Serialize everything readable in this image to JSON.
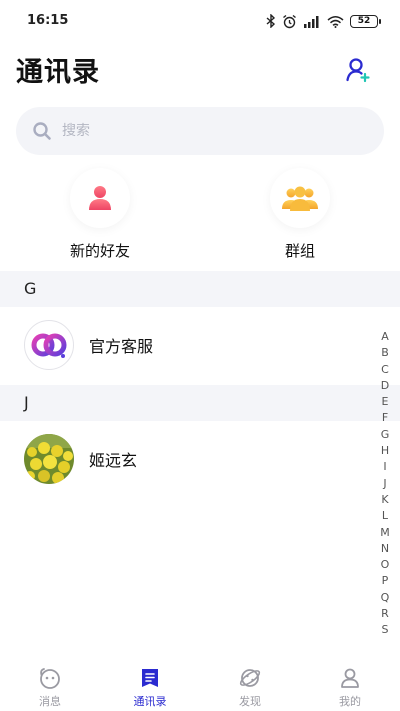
{
  "status_bar": {
    "time": "16:15",
    "battery": "52",
    "icons": [
      "bluetooth-icon",
      "alarm-icon",
      "signal-icon",
      "wifi-icon",
      "battery-icon"
    ]
  },
  "header": {
    "title": "通讯录",
    "add_contact_icon": "add-person-icon"
  },
  "search": {
    "placeholder": "搜索"
  },
  "quick_actions": [
    {
      "label": "新的好友",
      "icon": "person-icon",
      "color": "#f0566a"
    },
    {
      "label": "群组",
      "icon": "group-icon",
      "color": "#f7b23b"
    }
  ],
  "sections": [
    {
      "letter": "G",
      "contacts": [
        {
          "name": "官方客服",
          "avatar": "official-logo"
        }
      ]
    },
    {
      "letter": "J",
      "contacts": [
        {
          "name": "姬远玄",
          "avatar": "photo-flowers"
        }
      ]
    }
  ],
  "alphabet_index": [
    "A",
    "B",
    "C",
    "D",
    "E",
    "F",
    "G",
    "H",
    "I",
    "J",
    "K",
    "L",
    "M",
    "N",
    "O",
    "P",
    "Q",
    "R",
    "S"
  ],
  "tabbar": {
    "active_color": "#2b2bd0",
    "inactive_color": "#9a9aa2",
    "tabs": [
      {
        "label": "消息",
        "icon": "message-face-icon",
        "active": false
      },
      {
        "label": "通讯录",
        "icon": "contacts-book-icon",
        "active": true
      },
      {
        "label": "发现",
        "icon": "planet-icon",
        "active": false
      },
      {
        "label": "我的",
        "icon": "profile-icon",
        "active": false
      }
    ]
  }
}
